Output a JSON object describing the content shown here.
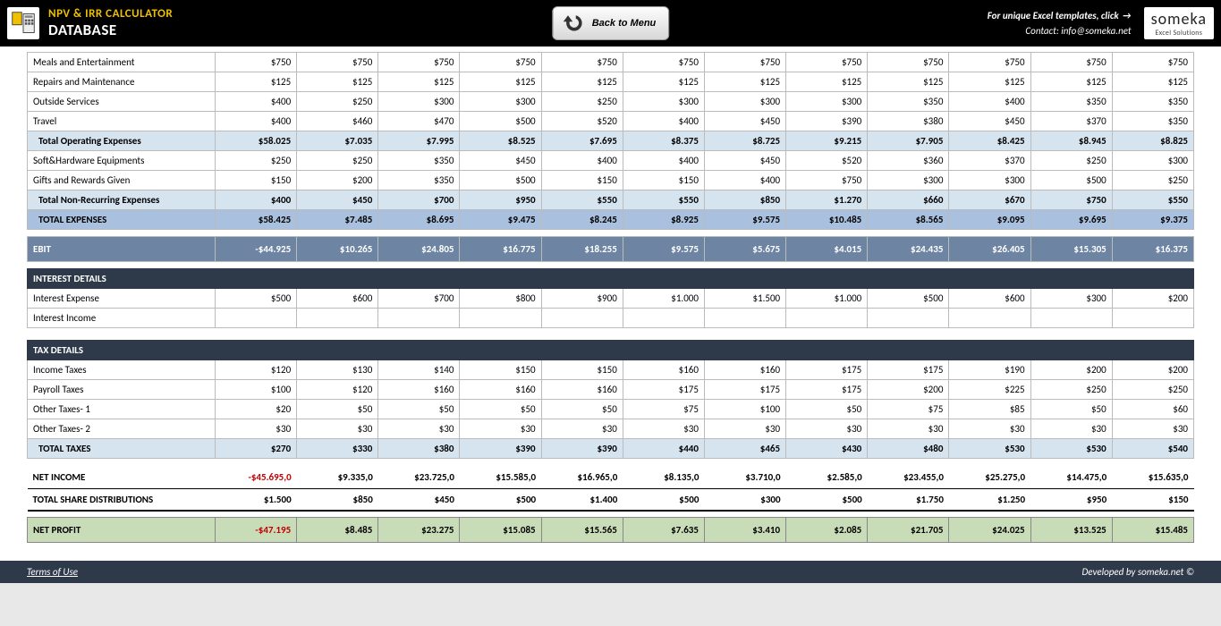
{
  "header": {
    "title": "NPV & IRR CALCULATOR",
    "subtitle": "DATABASE",
    "back": "Back to Menu",
    "link1a": "For unique Excel templates, ",
    "link1b": "click",
    "contact": "Contact: info@someka.net",
    "logo": "someka",
    "logo_sub": "Excel Solutions"
  },
  "rows": [
    {
      "t": "data",
      "label": "Meals and Entertainment",
      "v": [
        "$750",
        "$750",
        "$750",
        "$750",
        "$750",
        "$750",
        "$750",
        "$750",
        "$750",
        "$750",
        "$750",
        "$750"
      ]
    },
    {
      "t": "data",
      "label": "Repairs and Maintenance",
      "v": [
        "$125",
        "$125",
        "$125",
        "$125",
        "$125",
        "$125",
        "$125",
        "$125",
        "$125",
        "$125",
        "$125",
        "$125"
      ]
    },
    {
      "t": "data",
      "label": "Outside Services",
      "v": [
        "$400",
        "$250",
        "$300",
        "$300",
        "$250",
        "$300",
        "$300",
        "$300",
        "$350",
        "$400",
        "$350",
        "$350"
      ]
    },
    {
      "t": "data",
      "label": "Travel",
      "v": [
        "$400",
        "$460",
        "$470",
        "$500",
        "$520",
        "$400",
        "$450",
        "$390",
        "$380",
        "$450",
        "$370",
        "$350"
      ]
    },
    {
      "t": "subtotal",
      "label": "Total Operating Expenses",
      "v": [
        "$58.025",
        "$7.035",
        "$7.995",
        "$8.525",
        "$7.695",
        "$8.375",
        "$8.725",
        "$9.215",
        "$7.905",
        "$8.425",
        "$8.945",
        "$8.825"
      ]
    },
    {
      "t": "data",
      "label": "Soft&Hardware Equipments",
      "v": [
        "$250",
        "$250",
        "$350",
        "$450",
        "$400",
        "$400",
        "$450",
        "$520",
        "$360",
        "$370",
        "$250",
        "$300"
      ]
    },
    {
      "t": "data",
      "label": "Gifts and Rewards Given",
      "v": [
        "$150",
        "$200",
        "$350",
        "$500",
        "$150",
        "$150",
        "$400",
        "$750",
        "$300",
        "$300",
        "$500",
        "$250"
      ]
    },
    {
      "t": "subtotal",
      "label": "Total Non-Recurring Expenses",
      "v": [
        "$400",
        "$450",
        "$700",
        "$950",
        "$550",
        "$550",
        "$850",
        "$1.270",
        "$660",
        "$670",
        "$750",
        "$550"
      ]
    },
    {
      "t": "total-exp",
      "label": "TOTAL EXPENSES",
      "v": [
        "$58.425",
        "$7.485",
        "$8.695",
        "$9.475",
        "$8.245",
        "$8.925",
        "$9.575",
        "$10.485",
        "$8.565",
        "$9.095",
        "$9.695",
        "$9.375"
      ]
    },
    {
      "t": "spacer-sm"
    },
    {
      "t": "ebit",
      "label": "EBIT",
      "v": [
        "-$44.925",
        "$10.265",
        "$24.805",
        "$16.775",
        "$18.255",
        "$9.575",
        "$5.675",
        "$4.015",
        "$24.435",
        "$26.405",
        "$15.305",
        "$16.375"
      ]
    },
    {
      "t": "spacer-sm"
    },
    {
      "t": "section-hdr",
      "label": "INTEREST DETAILS",
      "v": [
        "",
        "",
        "",
        "",
        "",
        "",
        "",
        "",
        "",
        "",
        "",
        ""
      ]
    },
    {
      "t": "data",
      "label": "Interest Expense",
      "v": [
        "$500",
        "$600",
        "$700",
        "$800",
        "$900",
        "$1.000",
        "$1.500",
        "$1.000",
        "$500",
        "$600",
        "$300",
        "$200"
      ]
    },
    {
      "t": "data",
      "label": "Interest Income",
      "v": [
        "",
        "",
        "",
        "",
        "",
        "",
        "",
        "",
        "",
        "",
        "",
        ""
      ]
    },
    {
      "t": "spacer"
    },
    {
      "t": "section-hdr",
      "label": "TAX DETAILS",
      "v": [
        "",
        "",
        "",
        "",
        "",
        "",
        "",
        "",
        "",
        "",
        "",
        ""
      ]
    },
    {
      "t": "data",
      "label": "Income Taxes",
      "v": [
        "$120",
        "$130",
        "$140",
        "$150",
        "$150",
        "$160",
        "$160",
        "$175",
        "$175",
        "$190",
        "$200",
        "$200"
      ]
    },
    {
      "t": "data",
      "label": "Payroll Taxes",
      "v": [
        "$100",
        "$120",
        "$160",
        "$160",
        "$160",
        "$175",
        "$175",
        "$175",
        "$200",
        "$225",
        "$250",
        "$250"
      ]
    },
    {
      "t": "data",
      "label": "Other Taxes- 1",
      "v": [
        "$20",
        "$50",
        "$50",
        "$50",
        "$50",
        "$75",
        "$100",
        "$50",
        "$75",
        "$85",
        "$50",
        "$60"
      ]
    },
    {
      "t": "data",
      "label": "Other Taxes- 2",
      "v": [
        "$30",
        "$30",
        "$30",
        "$30",
        "$30",
        "$30",
        "$30",
        "$30",
        "$30",
        "$30",
        "$30",
        "$30"
      ]
    },
    {
      "t": "subtotal",
      "label": "TOTAL TAXES",
      "v": [
        "$270",
        "$330",
        "$380",
        "$390",
        "$390",
        "$440",
        "$465",
        "$430",
        "$480",
        "$530",
        "$530",
        "$540"
      ]
    },
    {
      "t": "spacer-sm"
    },
    {
      "t": "net-income",
      "label": "NET INCOME",
      "v": [
        "-$45.695,0",
        "$9.335,0",
        "$23.725,0",
        "$15.585,0",
        "$16.965,0",
        "$8.135,0",
        "$3.710,0",
        "$2.585,0",
        "$23.455,0",
        "$25.275,0",
        "$14.475,0",
        "$15.635,0"
      ]
    },
    {
      "t": "distrib",
      "label": "TOTAL SHARE DISTRIBUTIONS",
      "v": [
        "$1.500",
        "$850",
        "$450",
        "$500",
        "$1.400",
        "$500",
        "$300",
        "$500",
        "$1.750",
        "$1.250",
        "$950",
        "$150"
      ]
    },
    {
      "t": "spacer-sm"
    },
    {
      "t": "net-profit",
      "label": "NET PROFIT",
      "v": [
        "-$47.195",
        "$8.485",
        "$23.275",
        "$15.085",
        "$15.565",
        "$7.635",
        "$3.410",
        "$2.085",
        "$21.705",
        "$24.025",
        "$13.525",
        "$15.485"
      ]
    }
  ],
  "footer": {
    "terms": "Terms of Use",
    "dev": "Developed by someka.net ©"
  }
}
